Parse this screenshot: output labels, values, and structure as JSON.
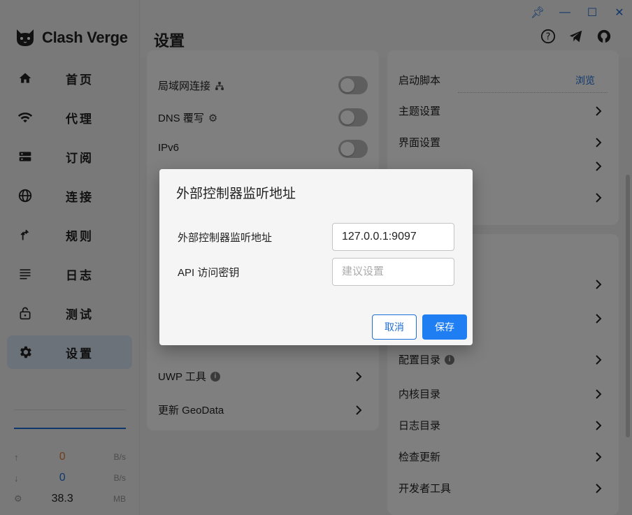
{
  "app": {
    "name": "Clash Verge"
  },
  "sidebar": {
    "items": [
      {
        "label": "首页",
        "icon": "home-icon"
      },
      {
        "label": "代理",
        "icon": "wifi-icon"
      },
      {
        "label": "订阅",
        "icon": "storage-icon"
      },
      {
        "label": "连接",
        "icon": "globe-icon"
      },
      {
        "label": "规则",
        "icon": "fork-icon"
      },
      {
        "label": "日志",
        "icon": "list-icon"
      },
      {
        "label": "测试",
        "icon": "lock-icon"
      },
      {
        "label": "设置",
        "icon": "gear-icon",
        "active": true
      }
    ],
    "traffic": {
      "up": {
        "value": "0",
        "unit": "B/s"
      },
      "down": {
        "value": "0",
        "unit": "B/s"
      },
      "memory": {
        "value": "38.3",
        "unit": "MB"
      }
    }
  },
  "header": {
    "title": "设置"
  },
  "left_card": {
    "rows": [
      {
        "label": "局域网连接"
      },
      {
        "label": "DNS 覆写"
      },
      {
        "label": "IPv6"
      },
      {
        "label": "UWP 工具"
      },
      {
        "label": "更新 GeoData"
      }
    ]
  },
  "right_card": {
    "startup_script": {
      "label": "启动脚本",
      "action": "浏览"
    },
    "rows_top": [
      "主题设置",
      "界面设置"
    ],
    "rows_bottom": [
      "配置目录",
      "内核目录",
      "日志目录",
      "检查更新",
      "开发者工具"
    ]
  },
  "dialog": {
    "title": "外部控制器监听地址",
    "controller_label": "外部控制器监听地址",
    "controller_value": "127.0.0.1:9097",
    "secret_label": "API 访问密钥",
    "secret_placeholder": "建议设置",
    "cancel": "取消",
    "save": "保存"
  },
  "colors": {
    "accent": "#1e7ef2",
    "upload": "#e07b39",
    "download": "#1e6fd9"
  }
}
